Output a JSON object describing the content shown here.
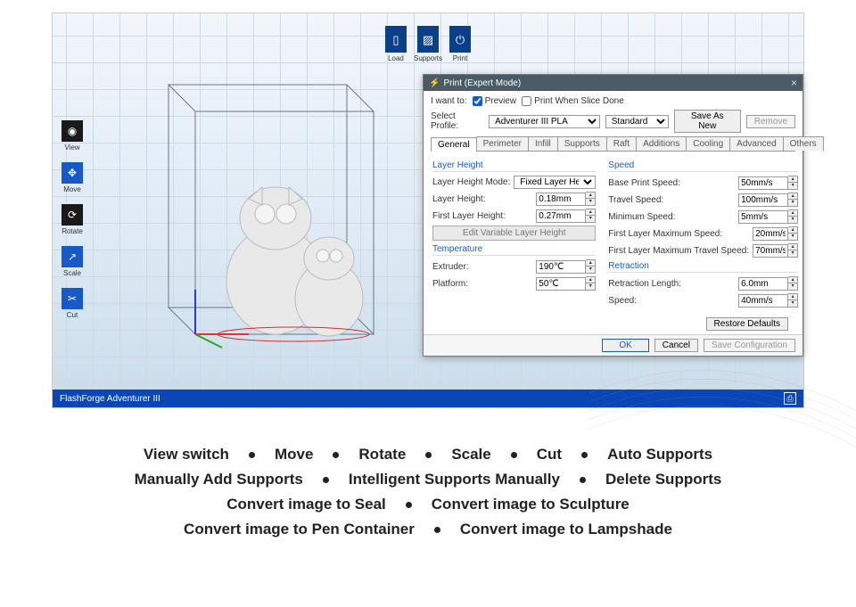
{
  "topbar": {
    "load": "Load",
    "supports": "Supports",
    "print": "Print"
  },
  "leftbar": {
    "view": "View",
    "move": "Move",
    "rotate": "Rotate",
    "scale": "Scale",
    "cut": "Cut"
  },
  "status": {
    "printer": "FlashForge Adventurer III"
  },
  "dialog": {
    "title": "Print (Expert Mode)",
    "i_want_to": "I want to:",
    "preview": "Preview",
    "print_when_done": "Print When Slice Done",
    "select_profile": "Select Profile:",
    "profile_value": "Adventurer III PLA",
    "quality_value": "Standard",
    "save_as_new": "Save As New",
    "remove": "Remove",
    "tabs": [
      "General",
      "Perimeter",
      "Infill",
      "Supports",
      "Raft",
      "Additions",
      "Cooling",
      "Advanced",
      "Others"
    ],
    "sections": {
      "layer_height": "Layer Height",
      "temperature": "Temperature",
      "speed": "Speed",
      "retraction": "Retraction"
    },
    "fields": {
      "layer_mode_label": "Layer Height Mode:",
      "layer_mode_value": "Fixed Layer Height",
      "layer_height_label": "Layer Height:",
      "layer_height_value": "0.18mm",
      "first_layer_label": "First Layer Height:",
      "first_layer_value": "0.27mm",
      "edit_variable": "Edit Variable Layer Height",
      "extruder_label": "Extruder:",
      "extruder_value": "190℃",
      "platform_label": "Platform:",
      "platform_value": "50℃",
      "base_speed_label": "Base Print Speed:",
      "base_speed_value": "50mm/s",
      "travel_speed_label": "Travel Speed:",
      "travel_speed_value": "100mm/s",
      "min_speed_label": "Minimum Speed:",
      "min_speed_value": "5mm/s",
      "fl_max_speed_label": "First Layer Maximum Speed:",
      "fl_max_speed_value": "20mm/s",
      "fl_max_travel_label": "First Layer Maximum Travel Speed:",
      "fl_max_travel_value": "70mm/s",
      "retract_len_label": "Retraction Length:",
      "retract_len_value": "6.0mm",
      "retract_speed_label": "Speed:",
      "retract_speed_value": "40mm/s"
    },
    "restore": "Restore Defaults",
    "ok": "OK",
    "cancel": "Cancel",
    "save_config": "Save Configuration"
  },
  "features": {
    "r1": [
      "View switch",
      "Move",
      "Rotate",
      "Scale",
      "Cut",
      "Auto Supports"
    ],
    "r2": [
      "Manually Add Supports",
      "Intelligent Supports Manually",
      "Delete Supports"
    ],
    "r3": [
      "Convert image to Seal",
      "Convert image to Sculpture"
    ],
    "r4": [
      "Convert image to Pen Container",
      "Convert image to Lampshade"
    ]
  }
}
